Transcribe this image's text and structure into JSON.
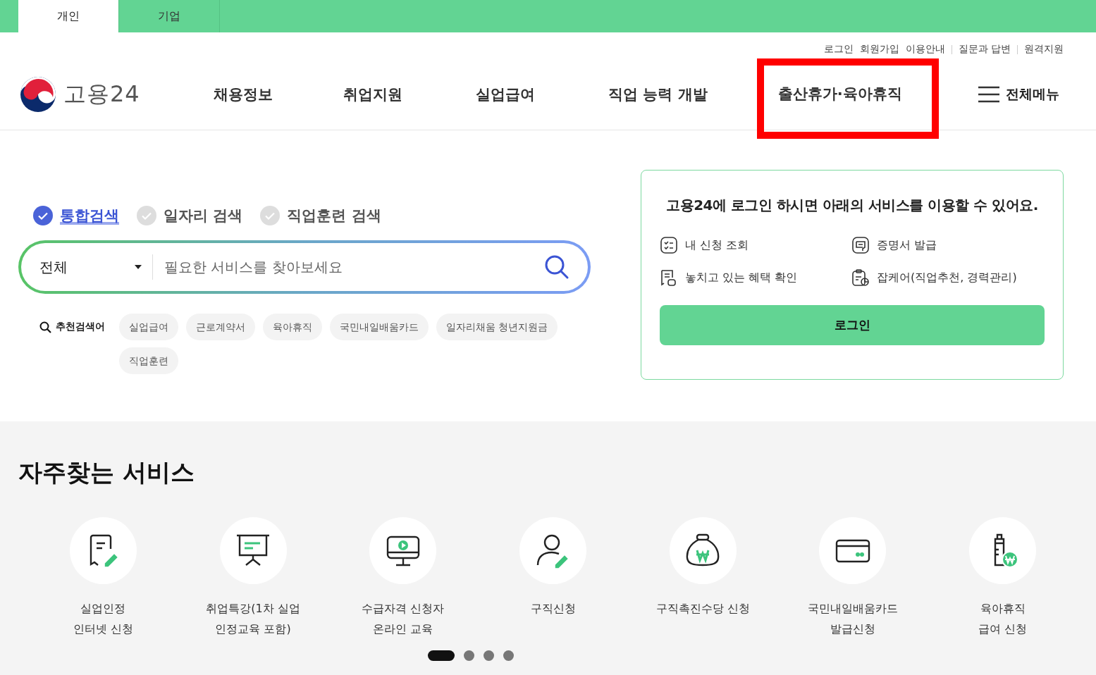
{
  "member_tabs": [
    {
      "label": "개인",
      "selected": true
    },
    {
      "label": "기업",
      "selected": false
    }
  ],
  "utility_links": [
    "로그인",
    "회원가입",
    "이용안내",
    "질문과 답변",
    "원격지원"
  ],
  "logo": {
    "text": "고용24"
  },
  "nav": [
    {
      "label": "채용정보",
      "highlighted": false
    },
    {
      "label": "취업지원",
      "highlighted": false
    },
    {
      "label": "실업급여",
      "highlighted": false
    },
    {
      "label": "직업 능력 개발",
      "highlighted": false
    },
    {
      "label": "출산휴가·육아휴직",
      "highlighted": true
    }
  ],
  "all_menu": "전체메뉴",
  "search_types": [
    {
      "label": "통합검색",
      "selected": true
    },
    {
      "label": "일자리 검색",
      "selected": false
    },
    {
      "label": "직업훈련 검색",
      "selected": false
    }
  ],
  "search": {
    "category": "전체",
    "placeholder": "필요한 서비스를 찾아보세요"
  },
  "recommended": {
    "label": "추천검색어",
    "keywords": [
      "실업급여",
      "근로계약서",
      "육아휴직",
      "국민내일배움카드",
      "일자리채움 청년지원금",
      "직업훈련"
    ]
  },
  "login_card": {
    "message": "고용24에 **로그인** 하시면 아래의 서비스를 이용할 수 있어요.",
    "services": [
      {
        "kind": "checklist",
        "label": "내 신청 조회"
      },
      {
        "kind": "certificate",
        "label": "증명서 발급"
      },
      {
        "kind": "benefit",
        "label": "놓치고 있는 혜택 확인"
      },
      {
        "kind": "clipboard",
        "label": "잡케어(직업추천, 경력관리)"
      }
    ],
    "button": "로그인"
  },
  "frequent": {
    "title": "자주찾는 서비스",
    "items": [
      {
        "kind": "document",
        "label": "실업인정\n인터넷 신청"
      },
      {
        "kind": "board",
        "label": "취업특강(1차 실업\n인정교육 포함)"
      },
      {
        "kind": "monitor",
        "label": "수급자격 신청자\n온라인 교육"
      },
      {
        "kind": "person",
        "label": "구직신청"
      },
      {
        "kind": "moneybag",
        "label": "구직촉진수당 신청"
      },
      {
        "kind": "card",
        "label": "국민내일배움카드\n발급신청"
      },
      {
        "kind": "bottle",
        "label": "육아휴직\n급여 신청"
      }
    ],
    "pages": [
      {
        "selected": true
      },
      {
        "selected": false
      },
      {
        "selected": false
      },
      {
        "selected": false
      }
    ]
  }
}
